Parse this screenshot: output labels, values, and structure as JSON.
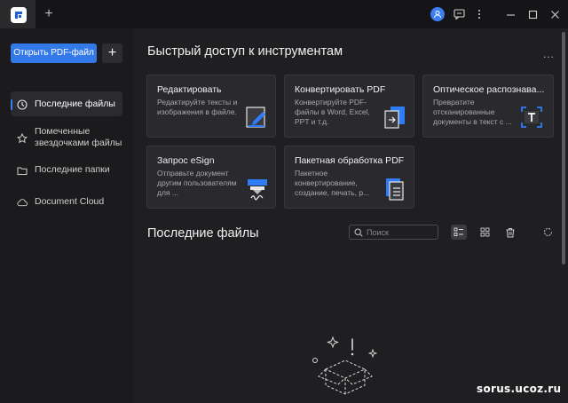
{
  "titlebar": {
    "new_tab_label": "+",
    "icons": [
      "app-logo-icon",
      "user-avatar-icon",
      "message-icon",
      "more-vertical-icon",
      "minimize-icon",
      "maximize-icon",
      "close-icon"
    ]
  },
  "sidebar": {
    "open_button": "Открыть PDF-файл",
    "add_button": "+",
    "items": [
      {
        "label": "Последние файлы",
        "icon": "clock-icon",
        "active": true
      },
      {
        "label": "Помеченные звездочками файлы",
        "icon": "star-icon",
        "active": false
      },
      {
        "label": "Последние папки",
        "icon": "folder-icon",
        "active": false
      },
      {
        "label": "Document Cloud",
        "icon": "cloud-icon",
        "active": false
      }
    ]
  },
  "quick_access": {
    "title": "Быстрый доступ к инструментам",
    "more": "...",
    "tools": [
      {
        "title": "Редактировать",
        "desc": "Редактируйте тексты и изображения в файле."
      },
      {
        "title": "Конвертировать PDF",
        "desc": "Конвертируйте PDF-файлы в Word, Excel, PPT и т.д."
      },
      {
        "title": "Оптическое распознава...",
        "desc": "Превратите отсканированные документы в текст с ..."
      },
      {
        "title": "Запрос eSign",
        "desc": "Отправьте документ другим пользователям для ..."
      },
      {
        "title": "Пакетная обработка PDF",
        "desc": "Пакетное конвертирование, создание, печать, р..."
      }
    ]
  },
  "recent": {
    "title": "Последние файлы",
    "search_placeholder": "Поиск"
  },
  "watermark": "sorus.ucoz.ru",
  "colors": {
    "accent": "#3479e8",
    "background": "#1f1f22",
    "sidebar": "#1b1b1d",
    "card": "#2a2a2e"
  }
}
